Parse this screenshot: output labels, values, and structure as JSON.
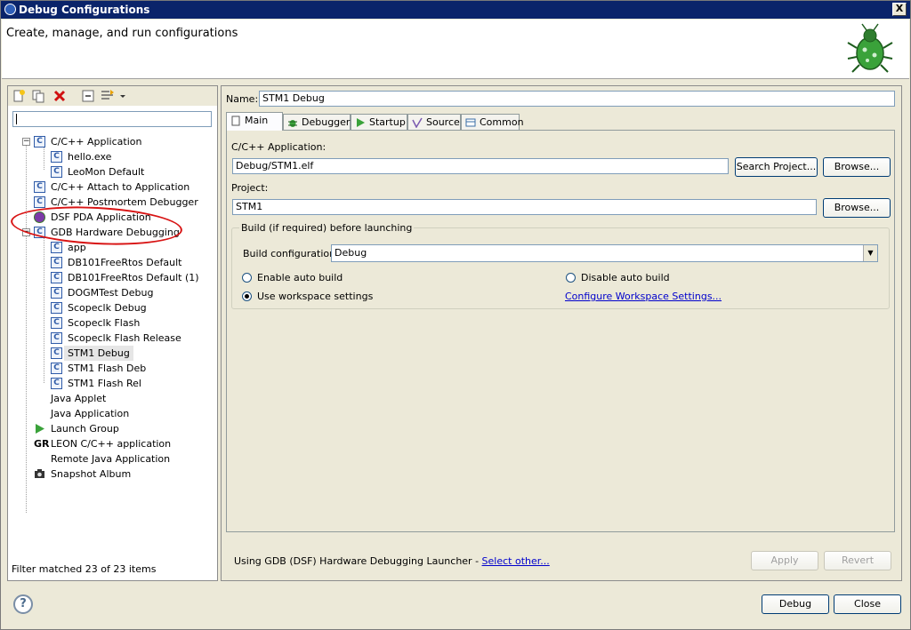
{
  "window": {
    "title": "Debug Configurations",
    "close_glyph": "X"
  },
  "header": {
    "text": "Create, manage, and run configurations"
  },
  "left": {
    "tree": [
      {
        "label": "C/C++ Application",
        "type": "folder"
      },
      {
        "label": "hello.exe",
        "type": "child"
      },
      {
        "label": "LeoMon Default",
        "type": "child"
      },
      {
        "label": "C/C++ Attach to Application",
        "type": "folder"
      },
      {
        "label": "C/C++ Postmortem Debugger",
        "type": "folder"
      },
      {
        "label": "DSF PDA Application",
        "type": "folder"
      },
      {
        "label": "GDB Hardware Debugging",
        "type": "folder"
      },
      {
        "label": "app",
        "type": "child"
      },
      {
        "label": "DB101FreeRtos Default",
        "type": "child"
      },
      {
        "label": "DB101FreeRtos Default (1)",
        "type": "child"
      },
      {
        "label": "DOGMTest Debug",
        "type": "child"
      },
      {
        "label": "Scopeclk Debug",
        "type": "child"
      },
      {
        "label": "Scopeclk Flash",
        "type": "child"
      },
      {
        "label": "Scopeclk Flash Release",
        "type": "child"
      },
      {
        "label": "STM1 Debug",
        "type": "child",
        "selected": true
      },
      {
        "label": "STM1 Flash Deb",
        "type": "child"
      },
      {
        "label": "STM1 Flash Rel",
        "type": "child"
      },
      {
        "label": "Java Applet",
        "type": "folder"
      },
      {
        "label": "Java Application",
        "type": "folder"
      },
      {
        "label": "Launch Group",
        "type": "folder"
      },
      {
        "label": "LEON C/C++ application",
        "type": "folder"
      },
      {
        "label": "Remote Java Application",
        "type": "folder"
      },
      {
        "label": "Snapshot Album",
        "type": "folder"
      }
    ],
    "filter_status": "Filter matched 23 of 23 items"
  },
  "right": {
    "name_label": "Name:",
    "name_value": "STM1 Debug",
    "tabs": [
      "Main",
      "Debugger",
      "Startup",
      "Source",
      "Common"
    ],
    "app_label": "C/C++ Application:",
    "app_value": "Debug/STM1.elf",
    "search_project": "Search Project...",
    "browse": "Browse...",
    "project_label": "Project:",
    "project_value": "STM1",
    "build_group": "Build (if required) before launching",
    "build_config_label": "Build configuration:",
    "build_config_value": "Debug",
    "enable_auto": "Enable auto build",
    "disable_auto": "Disable auto build",
    "use_workspace": "Use workspace settings",
    "configure_ws": "Configure Workspace Settings...",
    "launcher_text": "Using GDB (DSF) Hardware Debugging Launcher - ",
    "select_other": "Select other...",
    "apply": "Apply",
    "revert": "Revert"
  },
  "footer": {
    "debug": "Debug",
    "close": "Close",
    "help_glyph": "?"
  },
  "colors": {
    "titlebar": "#0a246a",
    "annotation": "#d81414",
    "link": "#0000cc"
  }
}
